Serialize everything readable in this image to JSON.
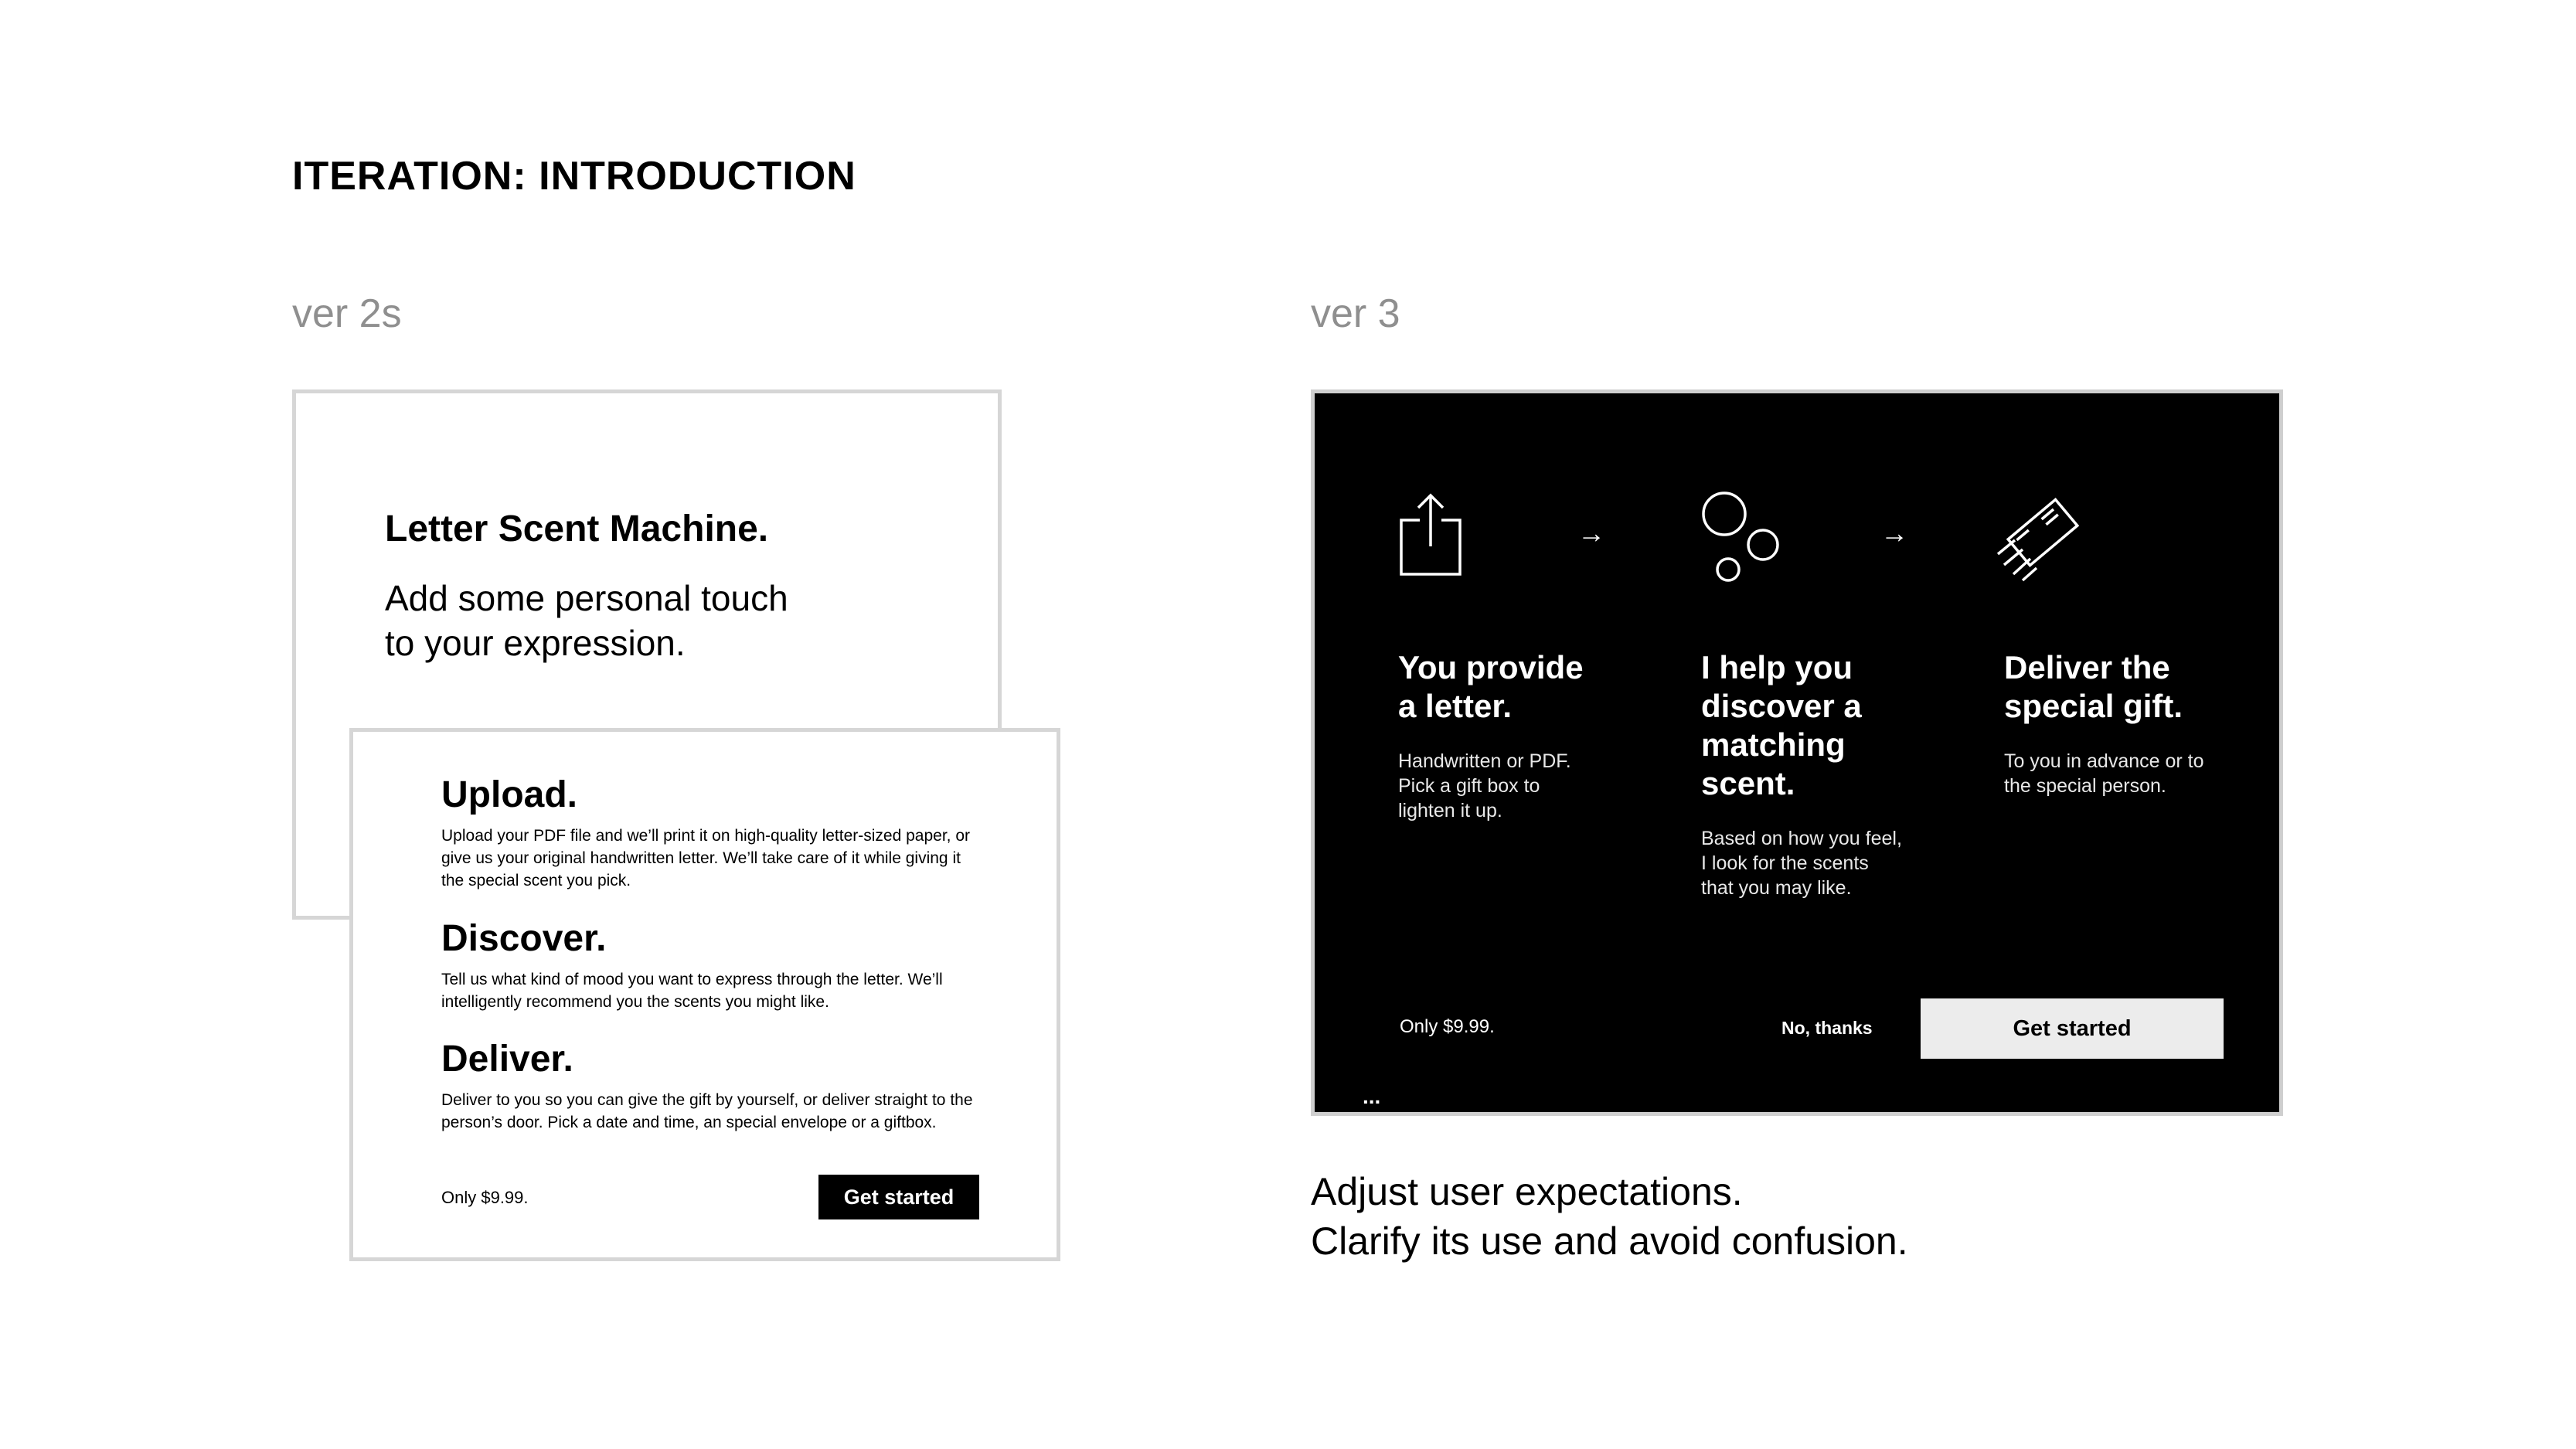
{
  "page": {
    "title": "ITERATION: INTRODUCTION",
    "caption_lines": [
      "Adjust user expectations.",
      "Clarify its use and avoid confusion."
    ]
  },
  "ver2s": {
    "label": "ver 2s",
    "intro": {
      "title": "Letter Scent Machine.",
      "subtitle_lines": [
        "Add some personal touch",
        "to your expression."
      ]
    },
    "sections": [
      {
        "title": "Upload.",
        "body": "Upload your PDF file and we’ll print it on high-quality letter-sized paper, or give us your original handwritten letter. We’ll take care of it while giving it the special scent you pick."
      },
      {
        "title": "Discover.",
        "body": "Tell us what kind of mood you want to express through the letter. We’ll intelligently recommend you the scents you might like."
      },
      {
        "title": "Deliver.",
        "body": "Deliver to you so you can give the gift by yourself, or deliver straight to the person’s door. Pick a date and time, an special envelope or a giftbox."
      }
    ],
    "price": "Only $9.99.",
    "cta": "Get started"
  },
  "ver3": {
    "label": "ver 3",
    "steps": [
      {
        "icon": "upload-icon",
        "title_lines": [
          "You provide",
          "a letter."
        ],
        "desc_lines": [
          "Handwritten or PDF.",
          "Pick a gift box to",
          "lighten it up."
        ]
      },
      {
        "icon": "bubbles-icon",
        "title_lines": [
          "I help you",
          "discover a",
          "matching",
          "scent."
        ],
        "desc_lines": [
          "Based on how you feel,",
          "I look for the scents",
          "that you may like."
        ]
      },
      {
        "icon": "flying-envelope-icon",
        "title_lines": [
          "Deliver the",
          "special gift."
        ],
        "desc_lines": [
          "To you in advance or to",
          "the special person."
        ]
      }
    ],
    "arrow_glyph": "→",
    "price": "Only $9.99.",
    "decline": "No, thanks",
    "cta": "Get started",
    "more_glyph": "..."
  },
  "colors": {
    "panel_bg": "#000000",
    "border_gray": "#d6d6d6",
    "label_gray": "#8f8f8f",
    "light_button": "#ececec"
  }
}
